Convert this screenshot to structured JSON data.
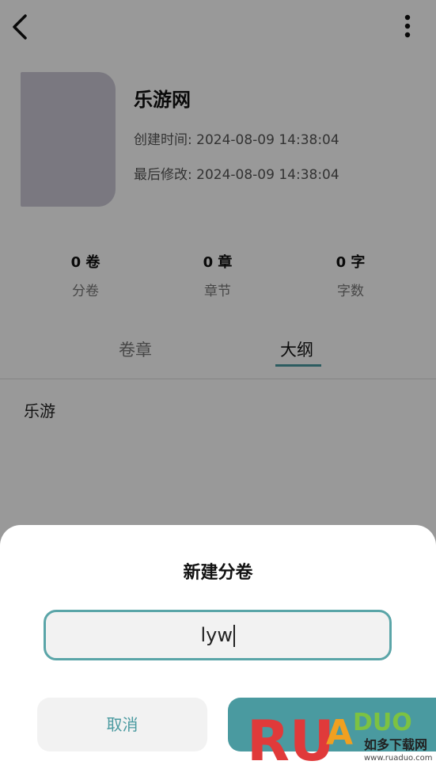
{
  "book": {
    "title": "乐游网",
    "created": "创建时间: 2024-08-09 14:38:04",
    "modified": "最后修改: 2024-08-09 14:38:04"
  },
  "stats": [
    {
      "value": "0 卷",
      "label": "分卷"
    },
    {
      "value": "0 章",
      "label": "章节"
    },
    {
      "value": "0 字",
      "label": "字数"
    }
  ],
  "tabs": [
    {
      "label": "卷章",
      "active": false
    },
    {
      "label": "大纲",
      "active": true
    }
  ],
  "outline": {
    "items": [
      "乐游"
    ]
  },
  "dialog": {
    "title": "新建分卷",
    "input_value": "lyw",
    "cancel_label": "取消"
  },
  "watermark": {
    "brand": "RUANDUO",
    "site_cn": "如多下载网",
    "url": "www.ruaduo.com"
  },
  "colors": {
    "accent": "#4a9aa0",
    "cover": "#cbc9d6"
  }
}
